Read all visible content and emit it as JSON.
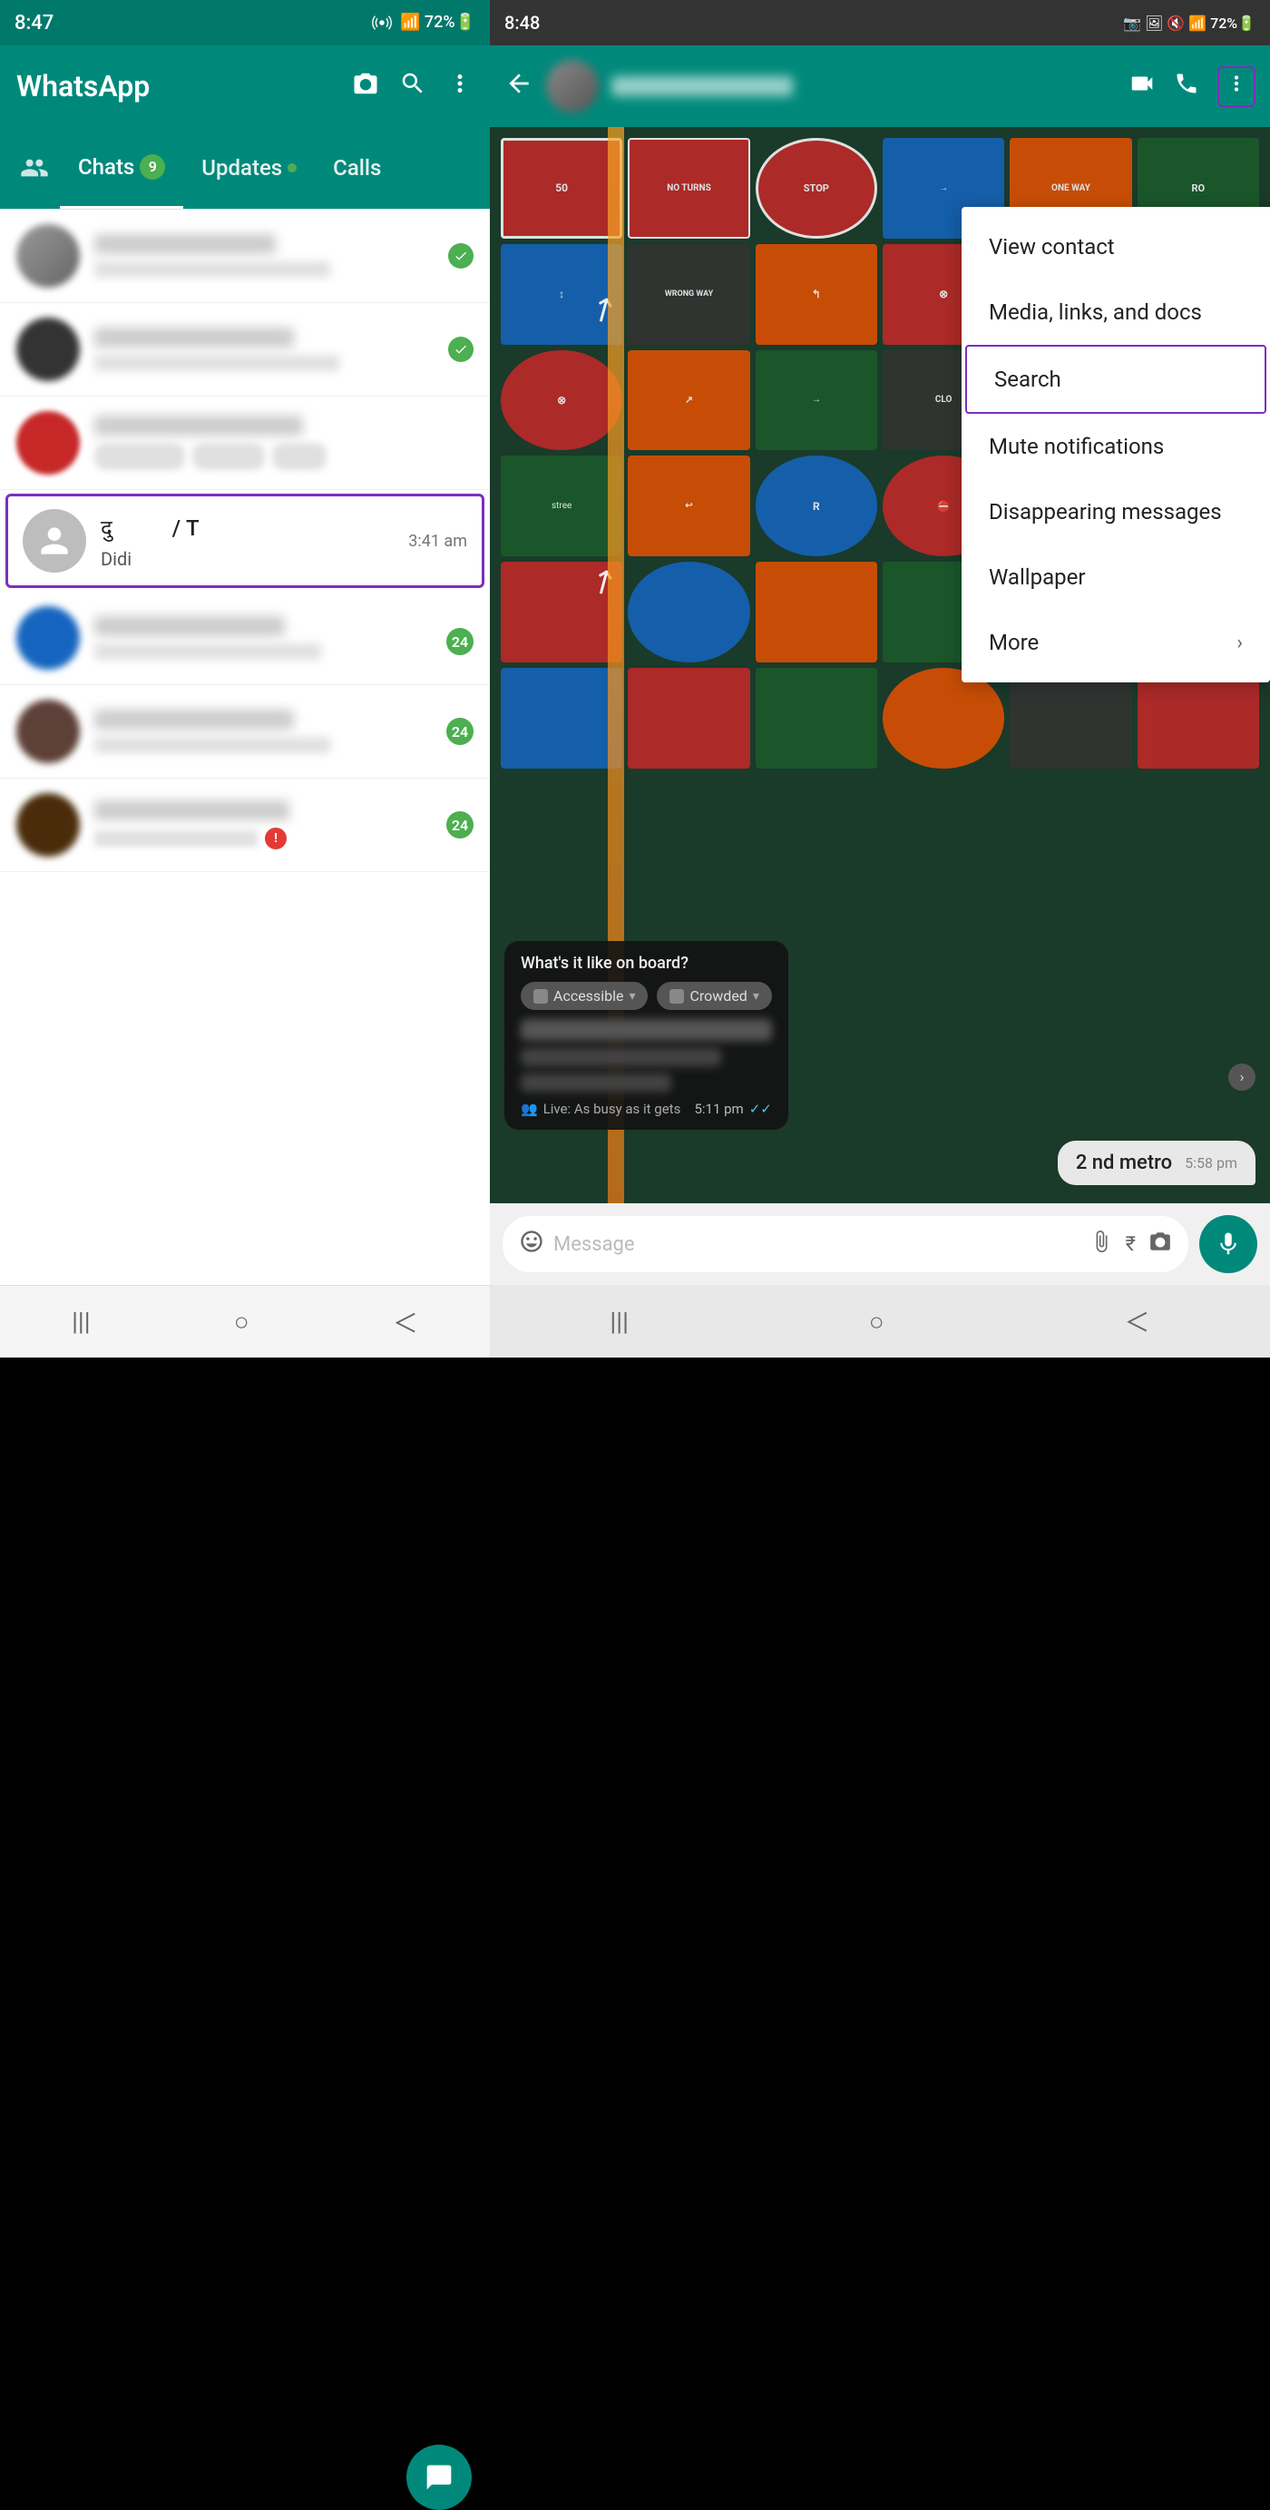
{
  "left": {
    "status_bar": {
      "time": "8:47",
      "icons": "📷 🔇 📶 72%🔋"
    },
    "header": {
      "title": "WhatsApp",
      "camera_icon": "📷",
      "search_icon": "🔍",
      "menu_icon": "⋮"
    },
    "tabs": [
      {
        "id": "community",
        "label": "👥",
        "icon": true
      },
      {
        "id": "chats",
        "label": "Chats",
        "badge": "9",
        "active": true
      },
      {
        "id": "updates",
        "label": "Updates",
        "dot": true
      },
      {
        "id": "calls",
        "label": "Calls"
      }
    ],
    "chats": [
      {
        "id": 1,
        "name": "blurred1",
        "preview": "blurred preview",
        "time": "",
        "unread": false,
        "avatar_color": "gray-blur"
      },
      {
        "id": 2,
        "name": "blurred2",
        "preview": "blurred preview",
        "time": "",
        "unread": true,
        "unread_count": "✓✓",
        "avatar_color": "dark-blur"
      },
      {
        "id": 3,
        "name": "blurred3",
        "preview": "blurred preview",
        "time": "",
        "unread": false,
        "avatar_color": "red-blur"
      },
      {
        "id": 4,
        "name": "दु... / T...",
        "name_visible": true,
        "preview": "Didi",
        "preview_visible": true,
        "time": "3:41 am",
        "unread": false,
        "avatar_color": "gray",
        "highlighted": true
      },
      {
        "id": 5,
        "name": "blurred5",
        "preview": "blurred preview",
        "time": "24",
        "unread": true,
        "unread_count": "24",
        "avatar_color": "blue-blur"
      },
      {
        "id": 6,
        "name": "blurred6",
        "preview": "blurred preview",
        "time": "24",
        "unread": true,
        "unread_count": "24",
        "avatar_color": "brown-blur"
      },
      {
        "id": 7,
        "name": "blurred7",
        "preview": "blurred preview",
        "time": "24",
        "unread": true,
        "unread_count": "24",
        "avatar_color": "dark-blur2"
      }
    ],
    "bottom_nav": [
      "|||",
      "○",
      "<"
    ]
  },
  "right": {
    "status_bar": {
      "time": "8:48",
      "icons": "📷 🖼 🔇 Voo 📶 72%🔋"
    },
    "header": {
      "back_icon": "←",
      "video_icon": "📹",
      "phone_icon": "📞",
      "menu_icon": "⋮"
    },
    "context_menu": {
      "items": [
        {
          "id": "view-contact",
          "label": "View contact",
          "highlighted": false
        },
        {
          "id": "media-links-docs",
          "label": "Media, links, and docs",
          "highlighted": false
        },
        {
          "id": "search",
          "label": "Search",
          "highlighted": true
        },
        {
          "id": "mute-notifications",
          "label": "Mute notifications",
          "highlighted": false
        },
        {
          "id": "disappearing-messages",
          "label": "Disappearing messages",
          "highlighted": false
        },
        {
          "id": "wallpaper",
          "label": "Wallpaper",
          "highlighted": false
        },
        {
          "id": "more",
          "label": "More",
          "has_arrow": true,
          "highlighted": false
        }
      ]
    },
    "messages": [
      {
        "id": 1,
        "type": "embed",
        "title": "What's it like on board?",
        "options": [
          "Accessible",
          "Crowded"
        ],
        "time": "5:11 pm",
        "ticks": "✓✓"
      },
      {
        "id": 2,
        "type": "sent",
        "text": "2 nd metro",
        "time": "5:58 pm"
      }
    ],
    "input_bar": {
      "placeholder": "Message",
      "emoji_icon": "😊",
      "attach_icon": "📎",
      "rupee_icon": "₹",
      "camera_icon": "📷",
      "mic_icon": "🎤"
    },
    "bottom_nav": [
      "|||",
      "○",
      "<"
    ]
  }
}
